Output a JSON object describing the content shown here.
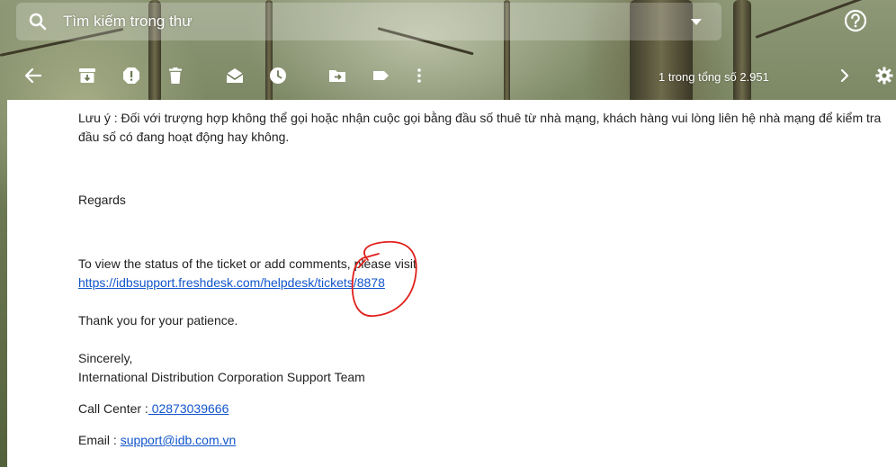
{
  "search": {
    "placeholder": "Tìm kiếm trong thư"
  },
  "toolbar": {
    "pager_text": "1 trong tổng số 2.951"
  },
  "email": {
    "note": "Lưu ý : Đối với trượng hợp không thể gọi hoặc nhận cuộc gọi bằng đầu số thuê từ nhà mạng, khách hàng vui lòng liên hệ nhà mạng để kiểm tra đầu số có đang hoạt động hay không.",
    "regards": "Regards",
    "ticket_intro": "To view the status of the ticket or add comments, please visit",
    "ticket_link": "https://idbsupport.freshdesk.com/helpdesk/tickets/8878",
    "thanks": "Thank you for your patience.",
    "sincerely": "Sincerely,",
    "team": "International Distribution Corporation Support Team",
    "call_label": "Call Center :",
    "call_number": " 02873039666",
    "email_label": "Email : ",
    "email_address": "support@idb.com.vn"
  },
  "colors": {
    "link": "#1155cc",
    "annotation": "#e0201c",
    "text": "#222222"
  }
}
